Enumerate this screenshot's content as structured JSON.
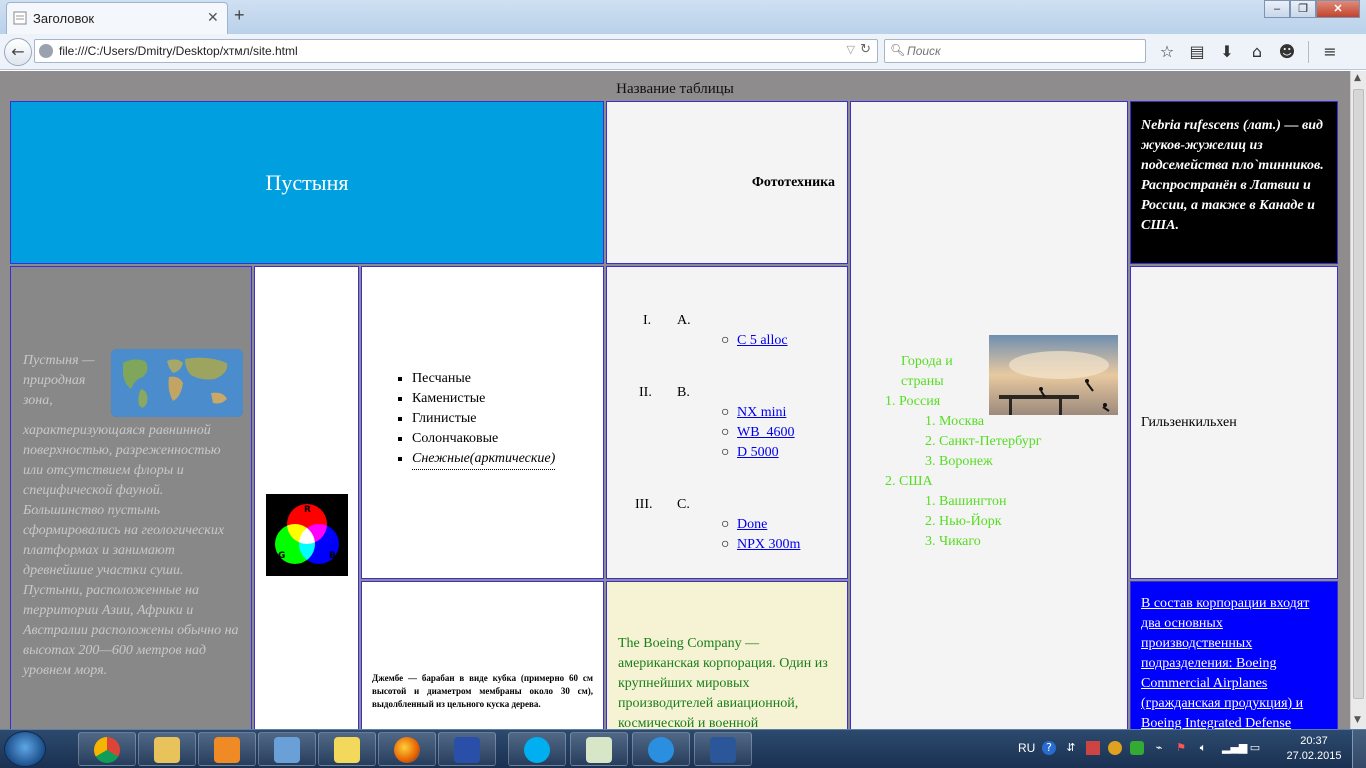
{
  "browser": {
    "tab_title": "Заголовок",
    "url": "file:///C:/Users/Dmitry/Desktop/хтмл/site.html",
    "search_placeholder": "Поиск"
  },
  "page": {
    "caption": "Название таблицы",
    "desert_title": "Пустыня",
    "photo_title": "Фототехника",
    "nebria_text": "Nebria rufescens (лат.) — вид жуков-жужелиц из подсемейства пло`тинников. Распространён в Латвии и России, а также в Канаде и США.",
    "desert_desc": "Пустыня — природная зона, характеризующаяся равнинной поверхностью, разреженностью или отсутствием флоры и специфической фауной. Большинство пустынь сформировались на геологических платформах и занимают древнейшие участки суши. Пустыни, расположенные на территории Азии, Африки и Австралии расположены обычно на высотах 200—600 метров над уровнем моря.",
    "desert_types": [
      "Песчаные",
      "Каменистые",
      "Глинистые",
      "Солончаковые",
      "Снежные(арктические)"
    ],
    "rgb": {
      "r": "R",
      "g": "G",
      "b": "B"
    },
    "cameras": {
      "groups": [
        {
          "roman": "I.",
          "letter": "A.",
          "items": [
            "C 5 alloc"
          ]
        },
        {
          "roman": "II.",
          "letter": "B.",
          "items": [
            "NX mini",
            "WB  4600",
            "D 5000"
          ]
        },
        {
          "roman": "III.",
          "letter": "C.",
          "items": [
            "Done",
            "NPX 300m"
          ]
        }
      ]
    },
    "cities": {
      "heading": "Города и страны",
      "countries": [
        {
          "num": "1.",
          "name": "Россия",
          "cities": [
            "Москва",
            "Санкт-Петербург",
            "Воронеж"
          ]
        },
        {
          "num": "2.",
          "name": "США",
          "cities": [
            "Вашингтон",
            "Нью-Йорк",
            "Чикаго"
          ]
        }
      ]
    },
    "gilz": "Гильзенкильхен",
    "djembe": "Джембе — барабан в виде кубка (примерно 60 см высотой и диаметром мембраны около 30 см), выдолбленный из цельного куска дерева.",
    "boeing": "The Boeing Company — американская корпорация. Один из крупнейших мировых производителей авиационной, космической и военной",
    "corp": "В состав корпорации входят два основных производственных подразделения: Boeing Commercial Airplanes (гражданская продукция) и Boeing Integrated Defense"
  },
  "taskbar": {
    "lang": "RU",
    "time": "20:37",
    "date": "27.02.2015"
  },
  "colors": {
    "desert_bg": "#009fe0",
    "cell_border": "#3a2fd4",
    "cities_green": "#55dd22",
    "boeing_green": "#1b7d1b",
    "corp_bg": "#0000ff"
  }
}
